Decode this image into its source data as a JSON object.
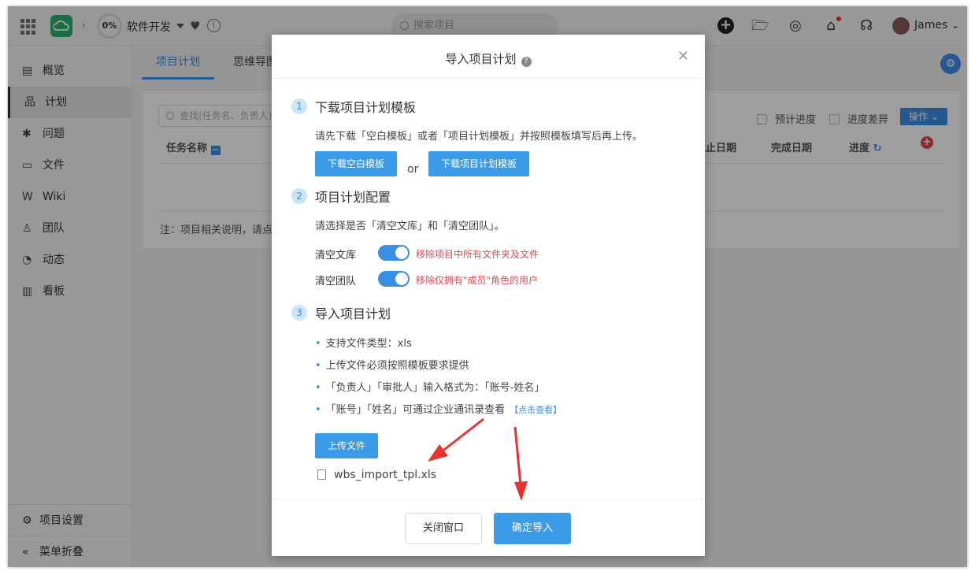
{
  "topbar": {
    "progress": "0%",
    "project": "软件开发",
    "search_placeholder": "搜索项目",
    "user": "James",
    "colors": {
      "logo": "#27b36f"
    }
  },
  "sidebar": {
    "items": [
      {
        "icon": "overview-icon",
        "label": "概览"
      },
      {
        "icon": "plan-icon",
        "label": "计划"
      },
      {
        "icon": "issue-icon",
        "label": "问题"
      },
      {
        "icon": "folder-icon",
        "label": "文件"
      },
      {
        "icon": "wiki-icon",
        "label": "Wiki"
      },
      {
        "icon": "team-icon",
        "label": "团队"
      },
      {
        "icon": "activity-icon",
        "label": "动态"
      },
      {
        "icon": "board-icon",
        "label": "看板"
      }
    ],
    "active": "计划",
    "settings": "项目设置",
    "collapse": "菜单折叠"
  },
  "tabs": {
    "plan": "项目计划",
    "mindmap": "思维导图"
  },
  "panel": {
    "find_placeholder": "查找(任务名、负责人)",
    "col_name": "任务名称",
    "col_deadline": "截止日期",
    "col_done": "完成日期",
    "col_progress": "进度",
    "chk_estimate": "预计进度",
    "chk_diff": "进度差异",
    "op_button": "操作",
    "note": "注：项目相关说明，请点"
  },
  "modal": {
    "title": "导入项目计划",
    "step1": {
      "num": "1",
      "title": "下载项目计划模板",
      "desc": "请先下载「空白模板」或者「项目计划模板」并按照模板填写后再上传。",
      "btn_blank": "下载空白模板",
      "or": "or",
      "btn_plan": "下载项目计划模板"
    },
    "step2": {
      "num": "2",
      "title": "项目计划配置",
      "desc": "请选择是否「清空文库」和「清空团队」。",
      "opt1_label": "清空文库",
      "opt1_hint": "移除项目中所有文件夹及文件",
      "opt2_label": "清空团队",
      "opt2_hint": "移除仅拥有\"成员\"角色的用户",
      "opt1_on": true,
      "opt2_on": true
    },
    "step3": {
      "num": "3",
      "title": "导入项目计划",
      "bullets": [
        "支持文件类型：xls",
        "上传文件必须按照模板要求提供",
        "「负责人」「审批人」输入格式为：「账号-姓名」",
        "「账号」「姓名」可通过企业通讯录查看"
      ],
      "link": "【点击查看】",
      "upload": "上传文件",
      "file": "wbs_import_tpl.xls"
    },
    "close": "关闭窗口",
    "confirm": "确定导入"
  }
}
